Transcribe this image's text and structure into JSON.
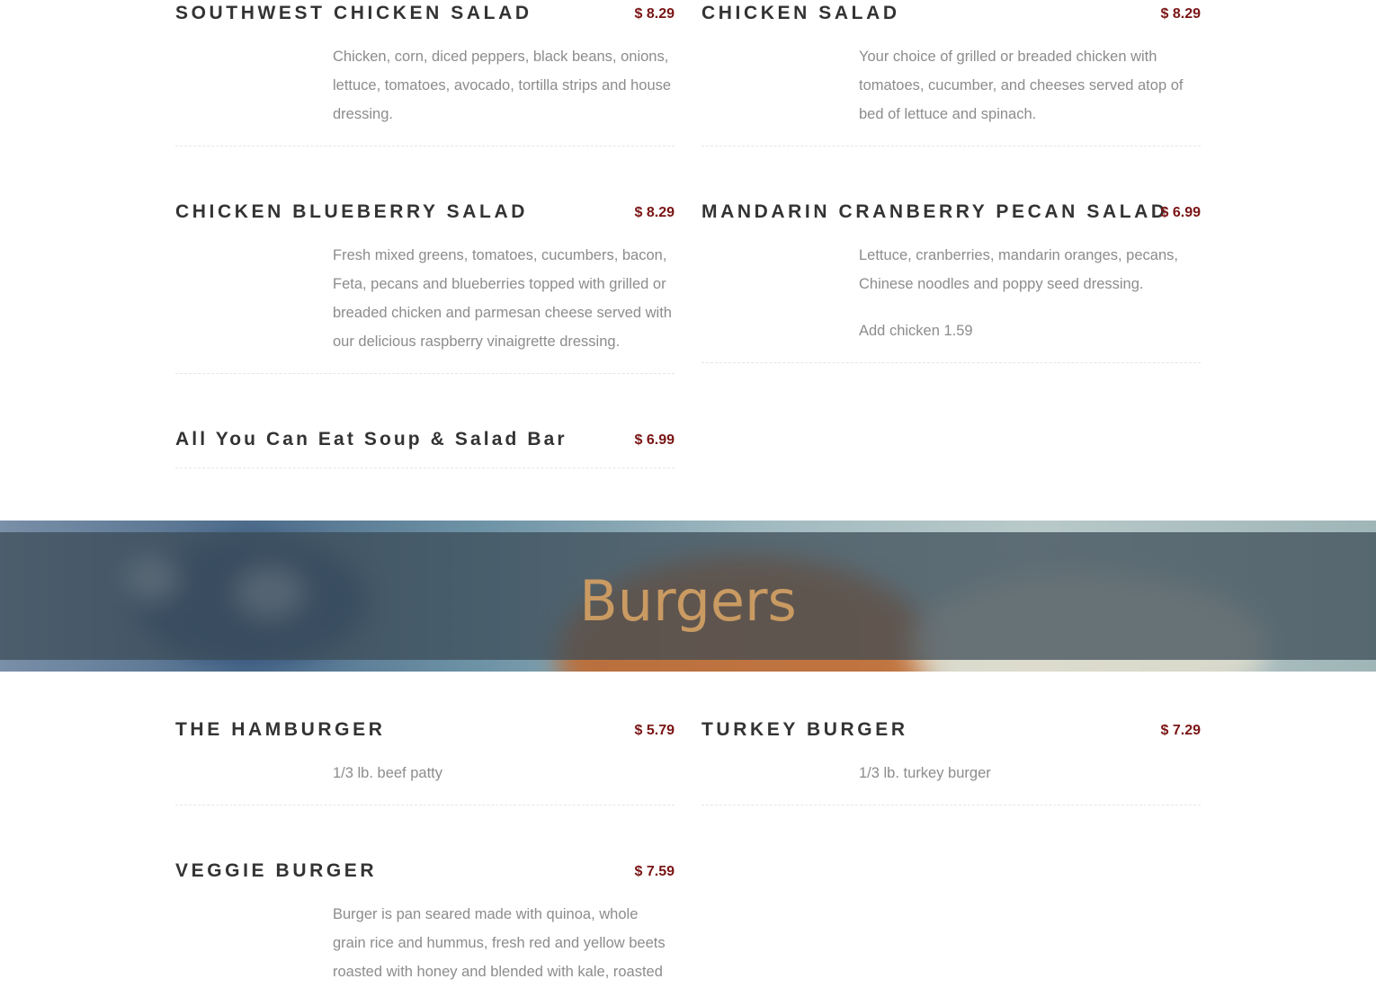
{
  "salads": {
    "left": [
      {
        "name": "SOUTHWEST CHICKEN SALAD",
        "price": "$ 8.29",
        "description": [
          "Chicken, corn, diced peppers, black beans, onions, lettuce, tomatoes, avocado, tortilla strips and house dressing."
        ]
      },
      {
        "name": "CHICKEN BLUEBERRY SALAD",
        "price": "$ 8.29",
        "description": [
          "Fresh mixed greens, tomatoes, cucumbers, bacon, Feta, pecans and blueberries topped with grilled or breaded chicken and parmesan cheese served with our delicious raspberry vinaigrette dressing."
        ]
      },
      {
        "name": "All You Can Eat Soup & Salad Bar",
        "price": "$ 6.99",
        "description": []
      }
    ],
    "right": [
      {
        "name": "CHICKEN SALAD",
        "price": "$ 8.29",
        "description": [
          "Your choice of grilled or breaded chicken with tomatoes, cucumber, and cheeses served atop of bed of lettuce and spinach."
        ]
      },
      {
        "name": "MANDARIN CRANBERRY PECAN SALAD",
        "price": "$ 6.99",
        "description": [
          "Lettuce, cranberries, mandarin oranges, pecans, Chinese noodles and poppy seed dressing.",
          "Add chicken 1.59"
        ]
      }
    ]
  },
  "burgers_banner": {
    "title": "Burgers"
  },
  "burgers": {
    "left": [
      {
        "name": "THE HAMBURGER",
        "price": "$ 5.79",
        "description": [
          "1/3 lb. beef patty"
        ]
      },
      {
        "name": "VEGGIE BURGER",
        "price": "$ 7.59",
        "description": [
          "Burger is pan seared made with quinoa, whole grain rice and hummus, fresh red and yellow beets roasted with honey and blended with kale, roasted"
        ]
      }
    ],
    "right": [
      {
        "name": "TURKEY BURGER",
        "price": "$ 7.29",
        "description": [
          "1/3 lb. turkey burger"
        ]
      }
    ]
  },
  "colors": {
    "title": "#333333",
    "price": "#7a1414",
    "description": "#8c8c8c",
    "banner_title": "#c99a62"
  }
}
